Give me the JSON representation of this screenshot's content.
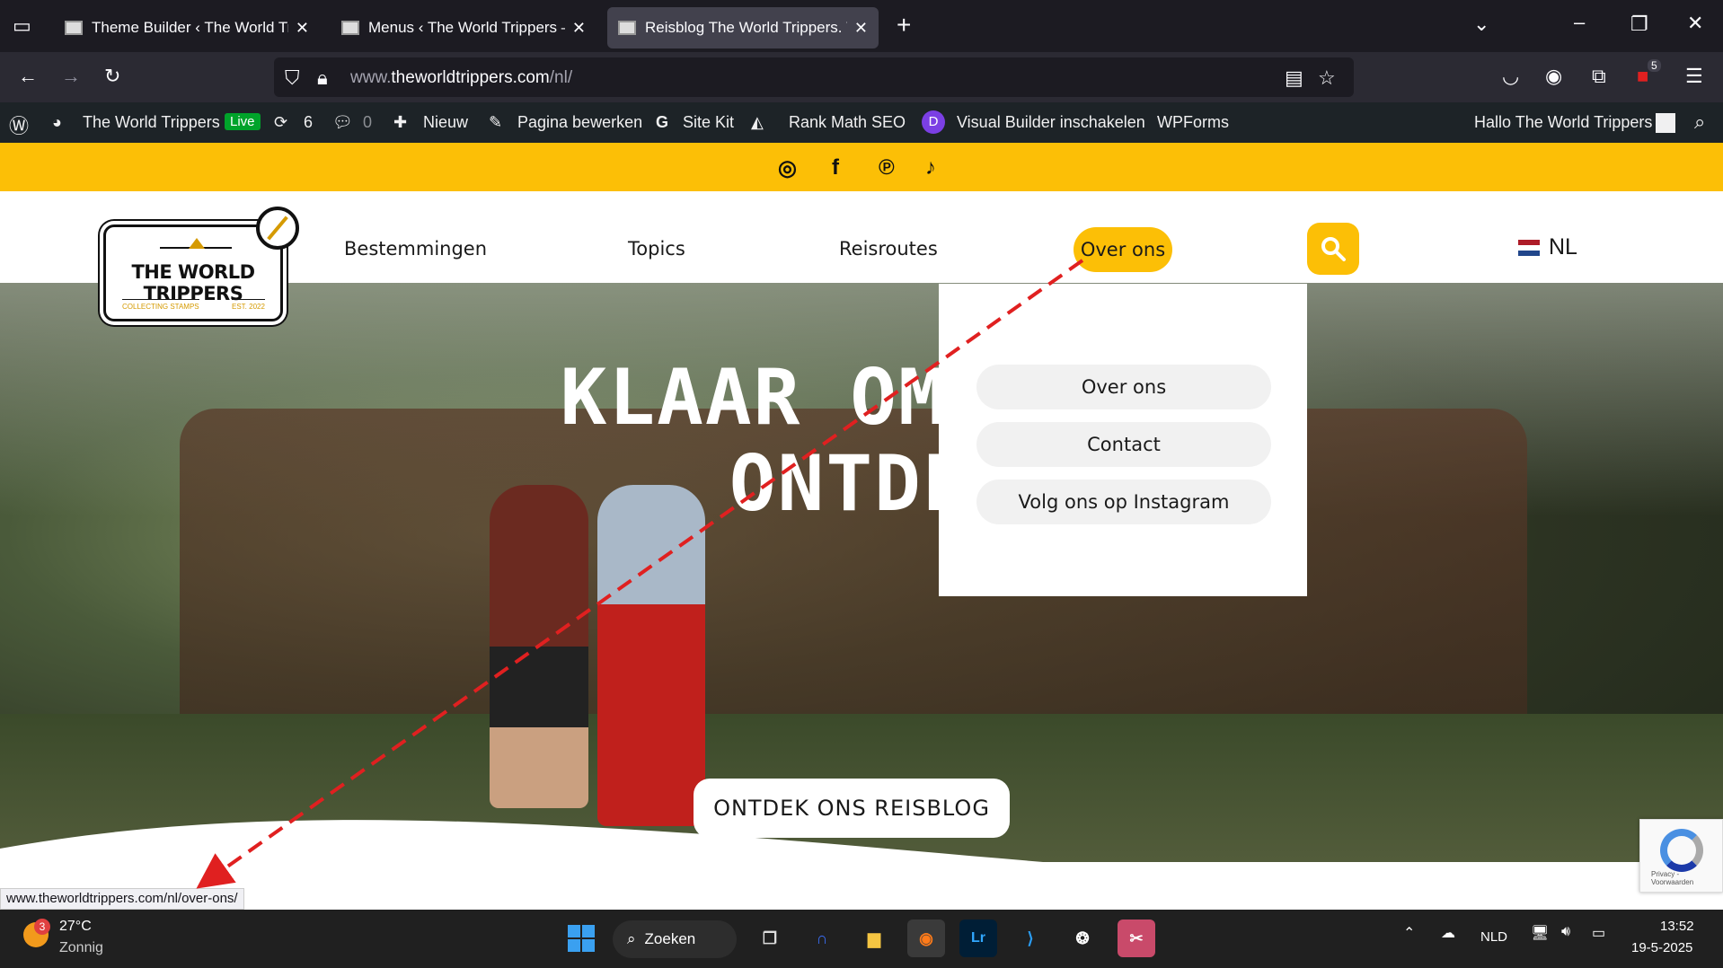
{
  "browser": {
    "tabs": [
      {
        "title": "Theme Builder ‹ The World Tripp",
        "active": false
      },
      {
        "title": "Menus ‹ The World Trippers — W",
        "active": false
      },
      {
        "title": "Reisblog The World Trippers. Vo",
        "active": true
      }
    ],
    "new_tab_label": "+",
    "url_prefix": "www.",
    "url_domain": "theworldtrippers.com",
    "url_path": "/nl/",
    "extension_badge": "5"
  },
  "wp_admin_bar": {
    "site_name": "The World Trippers",
    "live_badge": "Live",
    "updates_count": "6",
    "comments_count": "0",
    "new_label": "Nieuw",
    "edit_page_label": "Pagina bewerken",
    "sitekit_label": "Site Kit",
    "rankmath_label": "Rank Math SEO",
    "visual_builder_label": "Visual Builder inschakelen",
    "wpforms_label": "WPForms",
    "greeting": "Hallo The World Trippers"
  },
  "site": {
    "logo_title": "THE WORLD TRIPPERS",
    "logo_sub_left": "COLLECTING STAMPS",
    "logo_sub_right": "EST. 2022",
    "menu": {
      "bestemmingen": "Bestemmingen",
      "topics": "Topics",
      "reisroutes": "Reisroutes",
      "over_ons": "Over ons"
    },
    "language": "NL",
    "hero_line1": "KLAAR OM ONS R",
    "hero_line2": "ONTDEKK",
    "cta_label": "ONTDEK ONS REISBLOG",
    "dropdown": [
      "Over ons",
      "Contact",
      "Volg ons op Instagram"
    ],
    "recaptcha_label": "Privacy - Voorwaarden"
  },
  "status_url": "www.theworldtrippers.com/nl/over-ons/",
  "taskbar": {
    "weather_temp": "27°C",
    "weather_desc": "Zonnig",
    "weather_badge": "3",
    "search_label": "Zoeken",
    "language": "NLD",
    "time": "13:52",
    "date": "19-5-2025"
  },
  "colors": {
    "accent": "#fcbf06",
    "annotation_arrow": "#e02020"
  }
}
